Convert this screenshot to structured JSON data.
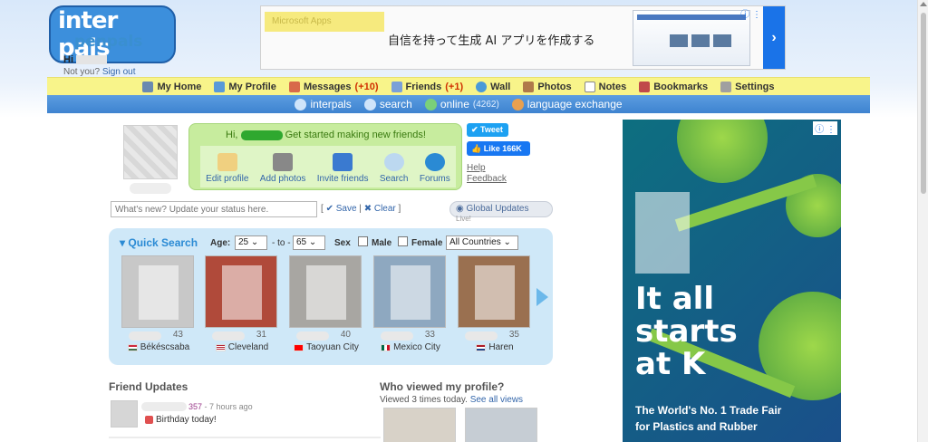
{
  "branding": {
    "logo_top": "inter pals",
    "logo_bottom": "penpals"
  },
  "user": {
    "greeting_prefix": "Hi",
    "not_you": "Not you?",
    "sign_out": "Sign out"
  },
  "ad_top": {
    "tag": "Microsoft Apps",
    "text": "自信を持って生成 AI アプリを作成する",
    "cta_glyph": "›"
  },
  "nav_main": [
    {
      "label": "My Home",
      "icon": "home-icon"
    },
    {
      "label": "My Profile",
      "icon": "profile-icon"
    },
    {
      "label": "Messages",
      "count": "(+10)",
      "icon": "envelope-icon"
    },
    {
      "label": "Friends",
      "count": "(+1)",
      "icon": "friends-icon"
    },
    {
      "label": "Wall",
      "icon": "wall-icon"
    },
    {
      "label": "Photos",
      "icon": "photos-icon"
    },
    {
      "label": "Notes",
      "icon": "notes-icon"
    },
    {
      "label": "Bookmarks",
      "icon": "bookmark-icon"
    },
    {
      "label": "Settings",
      "icon": "settings-icon"
    }
  ],
  "nav_sub": [
    {
      "label": "interpals",
      "icon": "globe-icon"
    },
    {
      "label": "search",
      "icon": "search-icon"
    },
    {
      "label": "online",
      "count": "(4262)",
      "icon": "online-icon"
    },
    {
      "label": "language exchange",
      "icon": "language-icon"
    }
  ],
  "welcome": {
    "hi": "Hi,",
    "message": "Get started making new friends!",
    "actions": [
      {
        "label": "Edit profile",
        "icon": "edit-profile-icon"
      },
      {
        "label": "Add photos",
        "icon": "camera-icon"
      },
      {
        "label": "Invite friends",
        "icon": "invite-icon"
      },
      {
        "label": "Search",
        "icon": "magnifier-icon"
      },
      {
        "label": "Forums",
        "icon": "forums-icon"
      }
    ]
  },
  "social": {
    "tweet": "Tweet",
    "like": "Like 166K",
    "help": "Help",
    "feedback": "Feedback"
  },
  "status": {
    "placeholder": "What's new? Update your status here.",
    "save": "Save",
    "clear": "Clear",
    "global_updates": "Global Updates",
    "live": "Live!"
  },
  "quick_search": {
    "title": "Quick Search",
    "age_label": "Age:",
    "age_from": "25",
    "to_label": "- to -",
    "age_to": "65",
    "sex_label": "Sex",
    "male_label": "Male",
    "female_label": "Female",
    "country": "All Countries",
    "results": [
      {
        "age": "43",
        "city": "Békéscsaba",
        "flag": "hungary-flag-icon"
      },
      {
        "age": "31",
        "city": "Cleveland",
        "flag": "usa-flag-icon"
      },
      {
        "age": "40",
        "city": "Taoyuan City",
        "flag": "taiwan-flag-icon"
      },
      {
        "age": "33",
        "city": "Mexico City",
        "flag": "mexico-flag-icon"
      },
      {
        "age": "35",
        "city": "Haren",
        "flag": "netherlands-flag-icon"
      }
    ]
  },
  "friend_updates": {
    "title": "Friend Updates",
    "items": [
      {
        "name_suffix": "357",
        "time": "- 7 hours ago",
        "text": "Birthday today!"
      }
    ]
  },
  "who_viewed": {
    "title": "Who viewed my profile?",
    "subtitle": "Viewed 3 times today.",
    "see_all": "See all views"
  },
  "ad_side": {
    "headline_lines": [
      "It all",
      "starts",
      "at K"
    ],
    "tagline_lines": [
      "The World's No. 1 Trade Fair",
      "for Plastics and Rubber"
    ]
  },
  "colors": {
    "nav_yellow": "#f8f48a",
    "nav_blue": "#3e83d0",
    "accent_red": "#d03000",
    "welcome_green": "#c7ec9e",
    "quick_search_bg": "#cfe8f8"
  }
}
